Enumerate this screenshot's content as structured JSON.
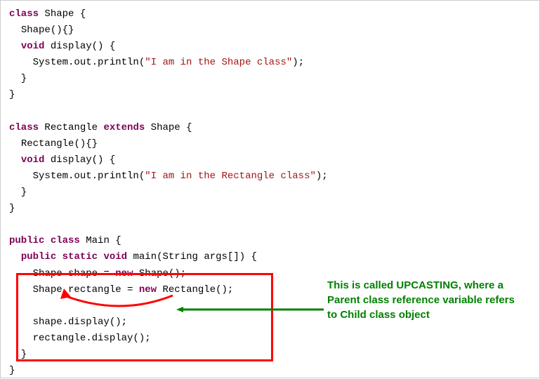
{
  "code": {
    "kw_class": "class",
    "kw_void": "void",
    "kw_extends": "extends",
    "kw_public": "public",
    "kw_static": "static",
    "kw_new": "new",
    "cls_shape": "Shape",
    "cls_rectangle": "Rectangle",
    "cls_main": "Main",
    "cls_string": "String",
    "ctor_shape": "Shape",
    "ctor_rectangle": "Rectangle",
    "method_display": "display",
    "method_main": "main",
    "sys_out_println": "System.out.println",
    "str_shape": "\"I am in the Shape class\"",
    "str_rect": "\"I am in the Rectangle class\"",
    "args": "args[]",
    "var_shape": "shape",
    "var_rectangle": "rectangle",
    "call_shape_display": "shape.display();",
    "call_rect_display": "rectangle.display();"
  },
  "annotation": {
    "text": "This is called UPCASTING, where a Parent class reference variable refers to Child class object"
  }
}
